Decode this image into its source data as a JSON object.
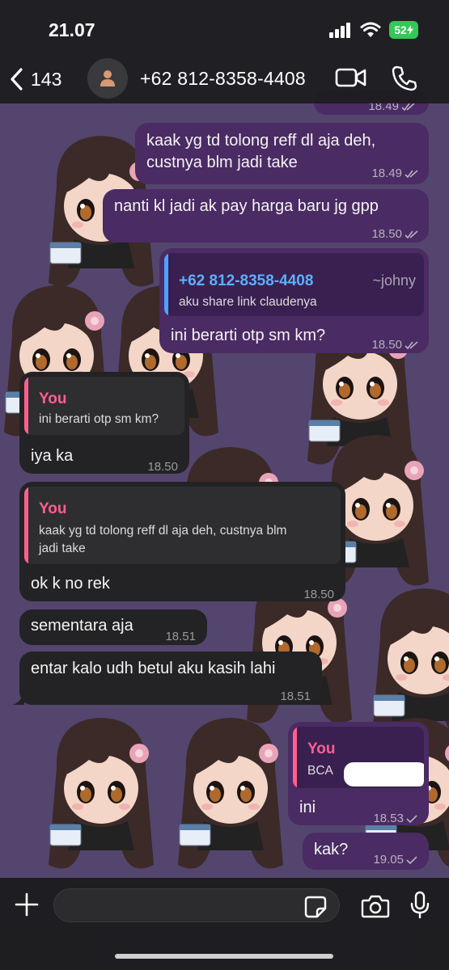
{
  "status_bar": {
    "time": "21.07",
    "battery": "52",
    "icons": [
      "signal-icon",
      "wifi-icon",
      "battery-charging-icon"
    ]
  },
  "header": {
    "back_count": "143",
    "contact": "+62 812-8358-4408",
    "icons": [
      "chevron-left-icon",
      "person-icon",
      "video-camera-icon",
      "phone-icon"
    ]
  },
  "messages": [
    {
      "dir": "out",
      "text": "",
      "time": "18.49",
      "status": "read"
    },
    {
      "dir": "out",
      "text_lines": [
        "kaak yg td tolong reff dl aja deh,",
        "custnya blm jadi take"
      ],
      "time": "18.49",
      "status": "read"
    },
    {
      "dir": "out",
      "text": "nanti kl jadi ak pay harga baru jg gpp",
      "time": "18.50",
      "status": "read"
    },
    {
      "dir": "out",
      "quote_author": "+62 812-8358-4408",
      "quote_alias": "~johny",
      "quote_text": "aku share link claudenya",
      "text": "ini berarti otp sm km?",
      "time": "18.50",
      "status": "read"
    },
    {
      "dir": "in",
      "quote_author": "You",
      "quote_text": "ini berarti otp sm km?",
      "text": "iya ka",
      "time": "18.50"
    },
    {
      "dir": "in",
      "quote_author": "You",
      "quote_text_lines": [
        "kaak yg td tolong reff dl aja deh, custnya blm",
        "jadi take"
      ],
      "text": "ok k no rek",
      "time": "18.50"
    },
    {
      "dir": "in",
      "text": "sementara aja",
      "time": "18.51"
    },
    {
      "dir": "in",
      "text": "entar kalo udh betul aku kasih lahi",
      "time": "18.51"
    },
    {
      "dir": "out",
      "quote_author": "You",
      "quote_text": "BCA",
      "text": "ini",
      "time": "18.53",
      "status": "sent"
    },
    {
      "dir": "out",
      "text": "kak?",
      "time": "19.05",
      "status": "sent"
    }
  ],
  "composer": {
    "placeholder": "",
    "icons": [
      "plus-icon",
      "sticker-icon",
      "camera-icon",
      "microphone-icon"
    ]
  },
  "colors": {
    "outgoing_bubble": "#4a2b63",
    "incoming_bubble": "#232325",
    "quote_you": "#ff5f8f",
    "quote_contact": "#4aa3ff",
    "battery": "#34c759",
    "wallpaper": "#54456e"
  }
}
